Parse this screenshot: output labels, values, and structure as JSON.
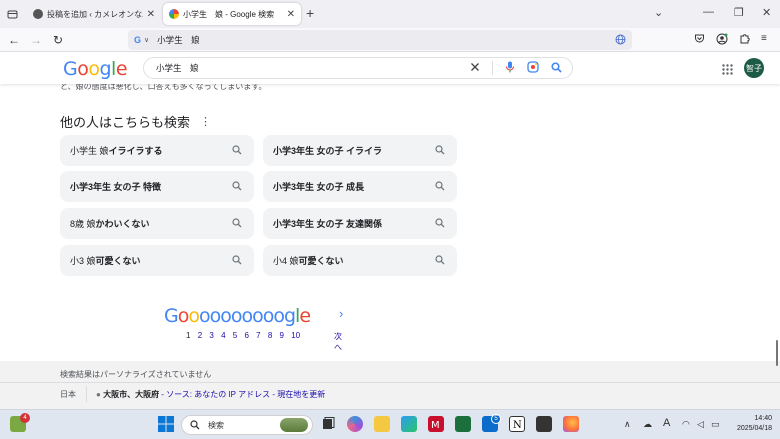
{
  "tabs": [
    {
      "title": "投稿を追加 ‹ カメレオンな二人暮らし",
      "active": false
    },
    {
      "title": "小学生　娘 - Google 検索",
      "active": true
    }
  ],
  "url_text": "小学生　娘",
  "search": {
    "query": "小学生　娘"
  },
  "avatar_label": "智子",
  "cut_off_text": "と、娘の態度は悪化し、口答えも多くなってしまいます。",
  "people_also_search": {
    "heading": "他の人はこちらも検索",
    "items": [
      {
        "norm": "小学生 娘 ",
        "bold": "イライラする"
      },
      {
        "norm": "",
        "bold": "小学3年生 女の子 イライラ"
      },
      {
        "norm": "",
        "bold": "小学3年生 女の子 特徴"
      },
      {
        "norm": "",
        "bold": "小学3年生 女の子 成長"
      },
      {
        "norm": "8歳 娘 ",
        "bold": "かわいくない"
      },
      {
        "norm": "",
        "bold": "小学3年生 女の子 友達関係"
      },
      {
        "norm": "小3 娘 ",
        "bold": "可愛くない"
      },
      {
        "norm": "小4 娘 ",
        "bold": "可愛くない"
      }
    ]
  },
  "pagination": {
    "pages": [
      "1",
      "2",
      "3",
      "4",
      "5",
      "6",
      "7",
      "8",
      "9",
      "10"
    ],
    "current": "1",
    "next_label": "次へ"
  },
  "footer": {
    "personalize_note": "検索結果はパーソナライズされていません",
    "country": "日本",
    "location": "大阪市、大阪府",
    "source_text": " - ソース: あなたの IP アドレス - ",
    "update_link": "現在地を更新"
  },
  "taskbar": {
    "search_placeholder": "検索",
    "time": "14:40",
    "date": "2025/04/18",
    "weather_badge": "4",
    "store_badge": "5"
  }
}
